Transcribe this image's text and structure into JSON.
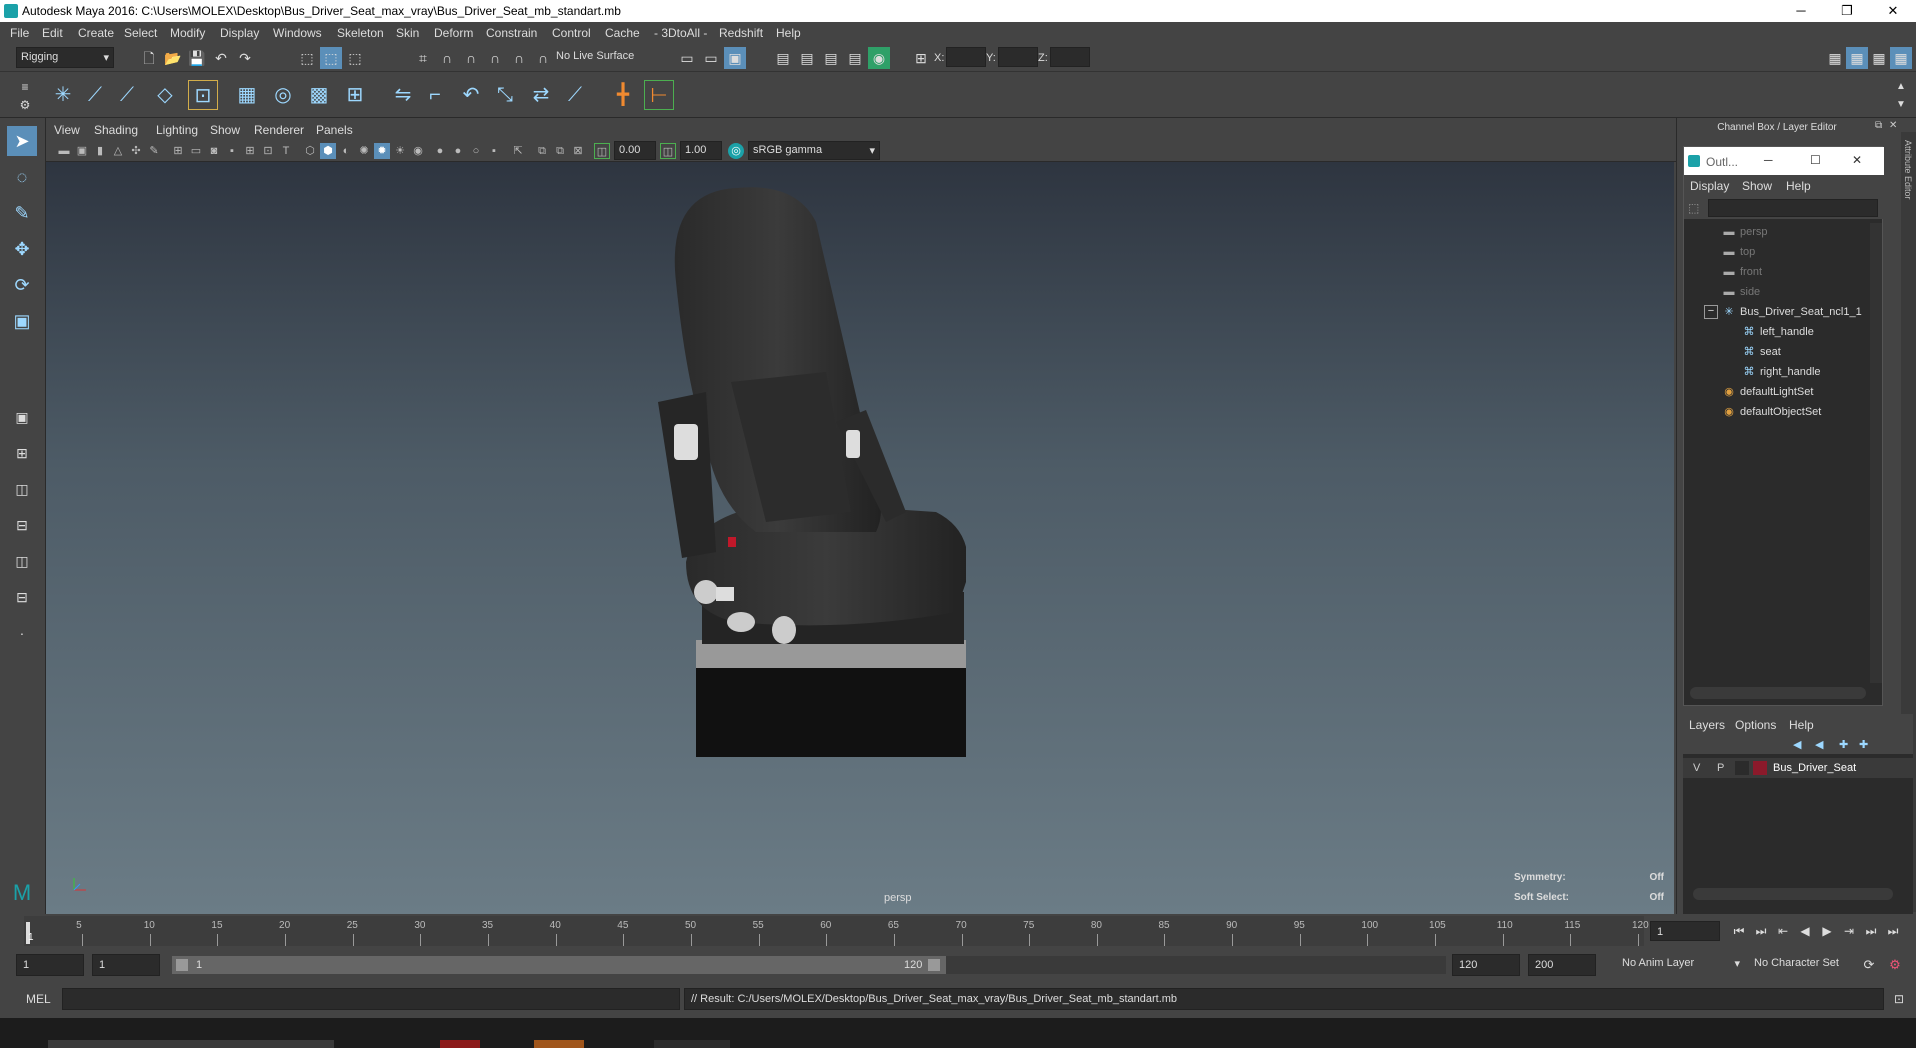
{
  "window": {
    "title": "Autodesk Maya 2016: C:\\Users\\MOLEX\\Desktop\\Bus_Driver_Seat_max_vray\\Bus_Driver_Seat_mb_standart.mb"
  },
  "menubar": [
    "File",
    "Edit",
    "Create",
    "Select",
    "Modify",
    "Display",
    "Windows",
    "Skeleton",
    "Skin",
    "Deform",
    "Constrain",
    "Control",
    "Cache",
    "- 3DtoAll -",
    "Redshift",
    "Help"
  ],
  "statusline": {
    "mode": "Rigging",
    "live_surface": "No Live Surface",
    "x_label": "X:",
    "y_label": "Y:",
    "z_label": "Z:"
  },
  "panel": {
    "menu": [
      "View",
      "Shading",
      "Lighting",
      "Show",
      "Renderer",
      "Panels"
    ],
    "near": "0.00",
    "far": "1.00",
    "colorspace": "sRGB gamma",
    "camera": "persp",
    "symmetry_label": "Symmetry:",
    "symmetry_value": "Off",
    "softselect_label": "Soft Select:",
    "softselect_value": "Off"
  },
  "channelbox": {
    "title": "Channel Box / Layer Editor"
  },
  "outliner": {
    "title": "Outl...",
    "menu": [
      "Display",
      "Show",
      "Help"
    ],
    "items": [
      {
        "label": "persp",
        "indent": 1,
        "dim": true,
        "icon": "camera-icon"
      },
      {
        "label": "top",
        "indent": 1,
        "dim": true,
        "icon": "camera-icon"
      },
      {
        "label": "front",
        "indent": 1,
        "dim": true,
        "icon": "camera-icon"
      },
      {
        "label": "side",
        "indent": 1,
        "dim": true,
        "icon": "camera-icon"
      },
      {
        "label": "Bus_Driver_Seat_ncl1_1",
        "indent": 1,
        "dim": false,
        "icon": "transform-icon"
      },
      {
        "label": "left_handle",
        "indent": 2,
        "dim": false,
        "icon": "mesh-icon"
      },
      {
        "label": "seat",
        "indent": 2,
        "dim": false,
        "icon": "mesh-icon"
      },
      {
        "label": "right_handle",
        "indent": 2,
        "dim": false,
        "icon": "mesh-icon"
      },
      {
        "label": "defaultLightSet",
        "indent": 1,
        "dim": false,
        "icon": "set-icon"
      },
      {
        "label": "defaultObjectSet",
        "indent": 1,
        "dim": false,
        "icon": "set-icon"
      }
    ]
  },
  "layers": {
    "menu": [
      "Layers",
      "Options",
      "Help"
    ],
    "rows": [
      {
        "v": "V",
        "p": "P",
        "name": "Bus_Driver_Seat",
        "color": "#8b1a2b"
      }
    ]
  },
  "timeline": {
    "ticks": [
      "5",
      "10",
      "15",
      "20",
      "25",
      "30",
      "35",
      "40",
      "45",
      "50",
      "55",
      "60",
      "65",
      "70",
      "75",
      "80",
      "85",
      "90",
      "95",
      "100",
      "105",
      "110",
      "115",
      "120"
    ],
    "current": "1",
    "current_field": "1"
  },
  "range": {
    "start": "1",
    "anim_start": "1",
    "slider_start": "1",
    "slider_end": "120",
    "end": "120",
    "anim_end": "200",
    "anim_layer": "No Anim Layer",
    "char_set": "No Character Set"
  },
  "commandline": {
    "lang": "MEL",
    "result": "// Result: C:/Users/MOLEX/Desktop/Bus_Driver_Seat_max_vray/Bus_Driver_Seat_mb_standart.mb"
  },
  "colors": {
    "accent": "#5b9bd5",
    "maya_teal": "#1ba1a8",
    "layer_red": "#8b1a2b"
  }
}
